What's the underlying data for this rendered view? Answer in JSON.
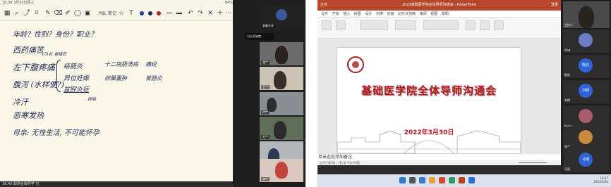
{
  "left_screen": {
    "status_time": "16:38  3月30日周三",
    "status_right": "64%",
    "note_title": "PBL 笔记",
    "pen_colors": [
      "#1c3b9e",
      "#1f2a55",
      "#b21f1f"
    ],
    "notes": [
      {
        "text": "年龄？性别？身份？职业？",
        "color": "blue"
      },
      {
        "text": "西药痛苦",
        "color": "blue"
      },
      {
        "text": "(5)右 肾结石",
        "color": "blue"
      },
      {
        "text": "左下腹疼痛",
        "color": "blue"
      },
      {
        "text": "结肠炎",
        "color": "blue"
      },
      {
        "text": "十二指肠溃疡",
        "color": "blue"
      },
      {
        "text": "痛经",
        "color": "blue"
      },
      {
        "text": "腹泻 (水样便?)",
        "color": "blue"
      },
      {
        "text": "异位妊娠",
        "color": "blue"
      },
      {
        "text": "卵巢囊肿",
        "color": "blue"
      },
      {
        "text": "胃肠炎",
        "color": "blue"
      },
      {
        "text": "盆腔炎症",
        "color": "blue"
      },
      {
        "text": "排除",
        "color": "blue"
      },
      {
        "text": "冷汗",
        "color": "blue"
      },
      {
        "text": "恶寒发热",
        "color": "blue"
      },
      {
        "text": "母亲: 无性生活, 不可能怀孕",
        "color": "blue"
      }
    ],
    "bottom_status": "16:40  职场仓库导学  已",
    "side_tag": "可以开始咯",
    "participants": [
      {
        "name": "屏幕共享"
      },
      {
        "name": "张**"
      },
      {
        "name": "王**"
      },
      {
        "name": "卢**"
      },
      {
        "name": "方**"
      },
      {
        "name": "刘**"
      },
      {
        "name": "李**"
      }
    ]
  },
  "right_screen": {
    "window_title": "2022基础医学院全体导师沟通会  -  PowerPoint",
    "window_left": "文件",
    "window_right": "登录",
    "ribbon_tabs": "文件 开始 插入 绘图 设计 切换 动画 幻灯片放映 审阅 视图 帮助",
    "slide": {
      "title": "基础医学院全体导师沟通会",
      "date": "2022年3月30日"
    },
    "notes_placeholder": "单击此处添加备注",
    "status_left": "幻灯片第1张，共1张   中文(中国)",
    "taskbar_time": "16:37",
    "taskbar_date": "2022/3/30",
    "videos": [
      {
        "name": "主持人",
        "avatar": "",
        "color": ""
      },
      {
        "name": "iPad",
        "avatar": "",
        "color": "#6e7dc8"
      },
      {
        "name": "陈欣",
        "avatar": "陈欣",
        "color": "#2f64d8"
      },
      {
        "name": "刘明",
        "avatar": "刘明",
        "color": "#2f64d8"
      },
      {
        "name": "Kerry",
        "avatar": "",
        "color": "#a95c6b"
      },
      {
        "name": "张**",
        "avatar": "",
        "color": "#c98a3f"
      },
      {
        "name": "王**",
        "avatar": "",
        "color": "#c2b68a"
      },
      {
        "name": "马瑶",
        "avatar": "马瑶",
        "color": "#2f64d8"
      }
    ]
  }
}
